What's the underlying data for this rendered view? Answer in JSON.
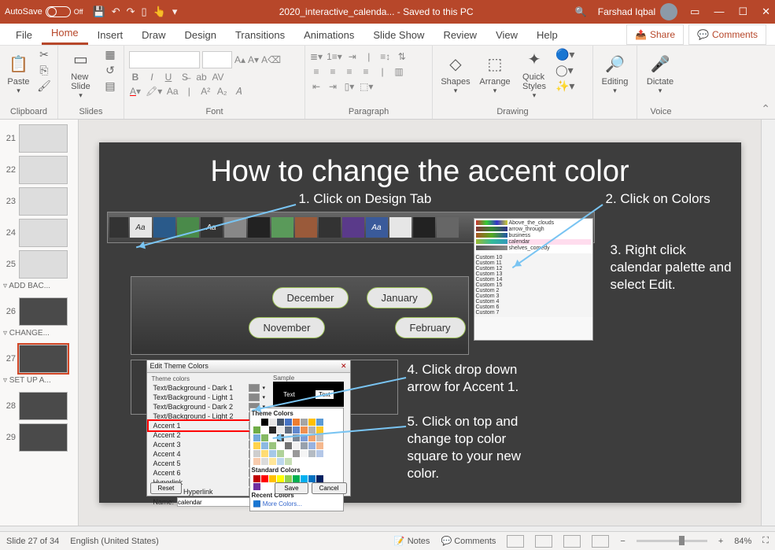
{
  "titlebar": {
    "autosave": "AutoSave",
    "filename": "2020_interactive_calenda... - Saved to this PC",
    "user": "Farshad Iqbal",
    "off": "Off"
  },
  "tabs": [
    "File",
    "Home",
    "Insert",
    "Draw",
    "Design",
    "Transitions",
    "Animations",
    "Slide Show",
    "Review",
    "View",
    "Help"
  ],
  "active_tab": "Home",
  "share": "Share",
  "comments": "Comments",
  "groups": {
    "clipboard": "Clipboard",
    "slides": "Slides",
    "font": "Font",
    "paragraph": "Paragraph",
    "drawing": "Drawing",
    "editing": "Editing",
    "voice": "Voice"
  },
  "buttons": {
    "paste": "Paste",
    "newslide": "New\nSlide",
    "shapes": "Shapes",
    "arrange": "Arrange",
    "quickstyles": "Quick\nStyles",
    "editing": "Editing",
    "dictate": "Dictate"
  },
  "thumbs": [
    {
      "n": "21",
      "cls": "light"
    },
    {
      "n": "22",
      "cls": "light"
    },
    {
      "n": "23",
      "cls": "light"
    },
    {
      "n": "24",
      "cls": "light"
    },
    {
      "n": "25",
      "cls": "light"
    },
    {
      "section": "▿ ADD BAC..."
    },
    {
      "n": "26",
      "cls": ""
    },
    {
      "section": "▿ CHANGE..."
    },
    {
      "n": "27",
      "cls": "selected"
    },
    {
      "section": "▿ SET UP A..."
    },
    {
      "n": "28",
      "cls": ""
    },
    {
      "n": "29",
      "cls": ""
    }
  ],
  "slide": {
    "title": "How to change the accent color",
    "step1": "1. Click on Design Tab",
    "step2": "2. Click on Colors",
    "step3": "3. Right click calendar palette and select Edit.",
    "step4": "4. Click drop down arrow for Accent 1.",
    "step5": "5. Click on top and change top color square to your new color.",
    "months": {
      "dec": "December",
      "jan": "January",
      "nov": "November",
      "feb": "February"
    },
    "dialog": {
      "title": "Edit Theme Colors",
      "sample": "Sample",
      "text": "Text",
      "rows": [
        "Text/Background - Dark 1",
        "Text/Background - Light 1",
        "Text/Background - Dark 2",
        "Text/Background - Light 2",
        "Accent 1",
        "Accent 2",
        "Accent 3",
        "Accent 4",
        "Accent 5",
        "Accent 6",
        "Hyperlink",
        "Followed Hyperlink"
      ],
      "theme_colors": "Theme Colors",
      "standard": "Standard Colors",
      "recent": "Recent Colors",
      "more": "More Colors...",
      "name": "Name:",
      "calendar": "calendar",
      "reset": "Reset",
      "save": "Save",
      "cancel": "Cancel"
    }
  },
  "status": {
    "slide": "Slide 27 of 34",
    "lang": "English (United States)",
    "notes": "Notes",
    "dcomments": "Comments",
    "zoom": "84%"
  }
}
